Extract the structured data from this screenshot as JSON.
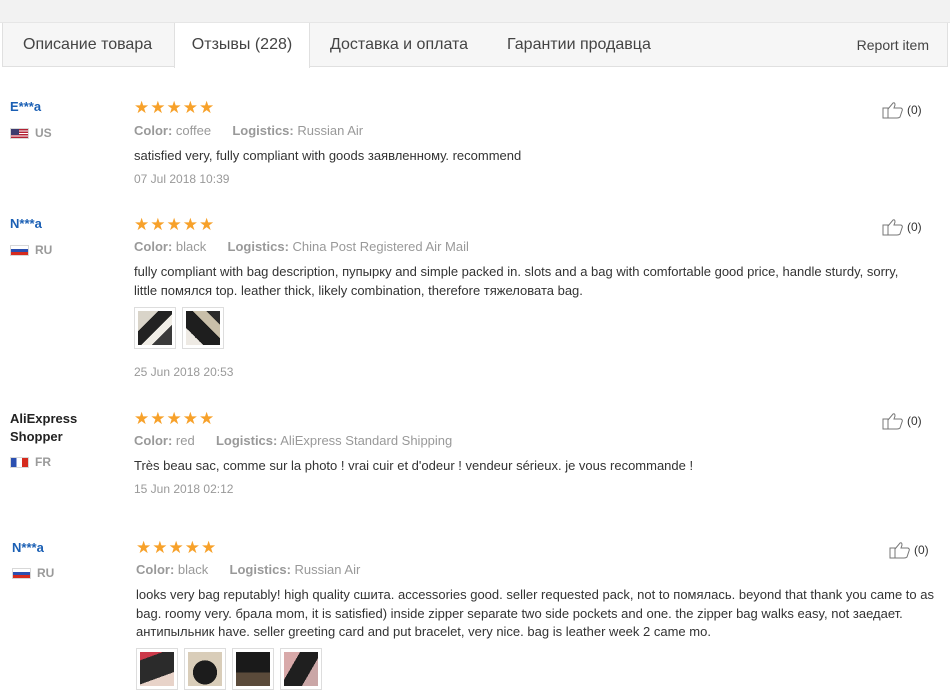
{
  "tabs": [
    {
      "label": "Описание товара"
    },
    {
      "label": "Отзывы (228)"
    },
    {
      "label": "Доставка и оплата"
    },
    {
      "label": "Гарантии продавца"
    }
  ],
  "report_label": "Report item",
  "labels": {
    "color": "Color:",
    "logistics": "Logistics:"
  },
  "reviews": [
    {
      "user": "E***a",
      "country": "US",
      "stars": "★★★★★",
      "color": "coffee",
      "logistics": "Russian Air",
      "text": "satisfied very, fully compliant with goods заявленному. recommend",
      "date": "07 Jul 2018 10:39",
      "helpful": "(0)",
      "rating": 5
    },
    {
      "user": "N***a",
      "country": "RU",
      "stars": "★★★★★",
      "color": "black",
      "logistics": "China Post Registered Air Mail",
      "text": "fully compliant with bag description, пупырку and simple packed in. slots and a bag with comfortable good price, handle sturdy, sorry, little помялся top. leather thick, likely combination, therefore тяжеловата bag.",
      "date": "25 Jun 2018 20:53",
      "helpful": "(0)",
      "rating": 5
    },
    {
      "user": "AliExpress Shopper",
      "country": "FR",
      "stars": "★★★★★",
      "color": "red",
      "logistics": "AliExpress Standard Shipping",
      "text": "Très beau sac, comme sur la photo ! vrai cuir et d'odeur ! vendeur sérieux. je vous recommande !",
      "date": "15 Jun 2018 02:12",
      "helpful": "(0)",
      "rating": 5
    },
    {
      "user": "N***a",
      "country": "RU",
      "stars": "★★★★★",
      "color": "black",
      "logistics": "Russian Air",
      "text": "looks very bag reputably! high quality сшита. accessories good. seller requested pack, not to помялась. beyond that thank you came to as bag. roomy very. брала mom, it is satisfied) inside zipper separate two side pockets and one. the zipper bag walks easy, not заедает. антипыльник have. seller greeting card and put bracelet, very nice. bag is leather week 2 came mo.",
      "helpful": "(0)",
      "rating": 5
    }
  ]
}
